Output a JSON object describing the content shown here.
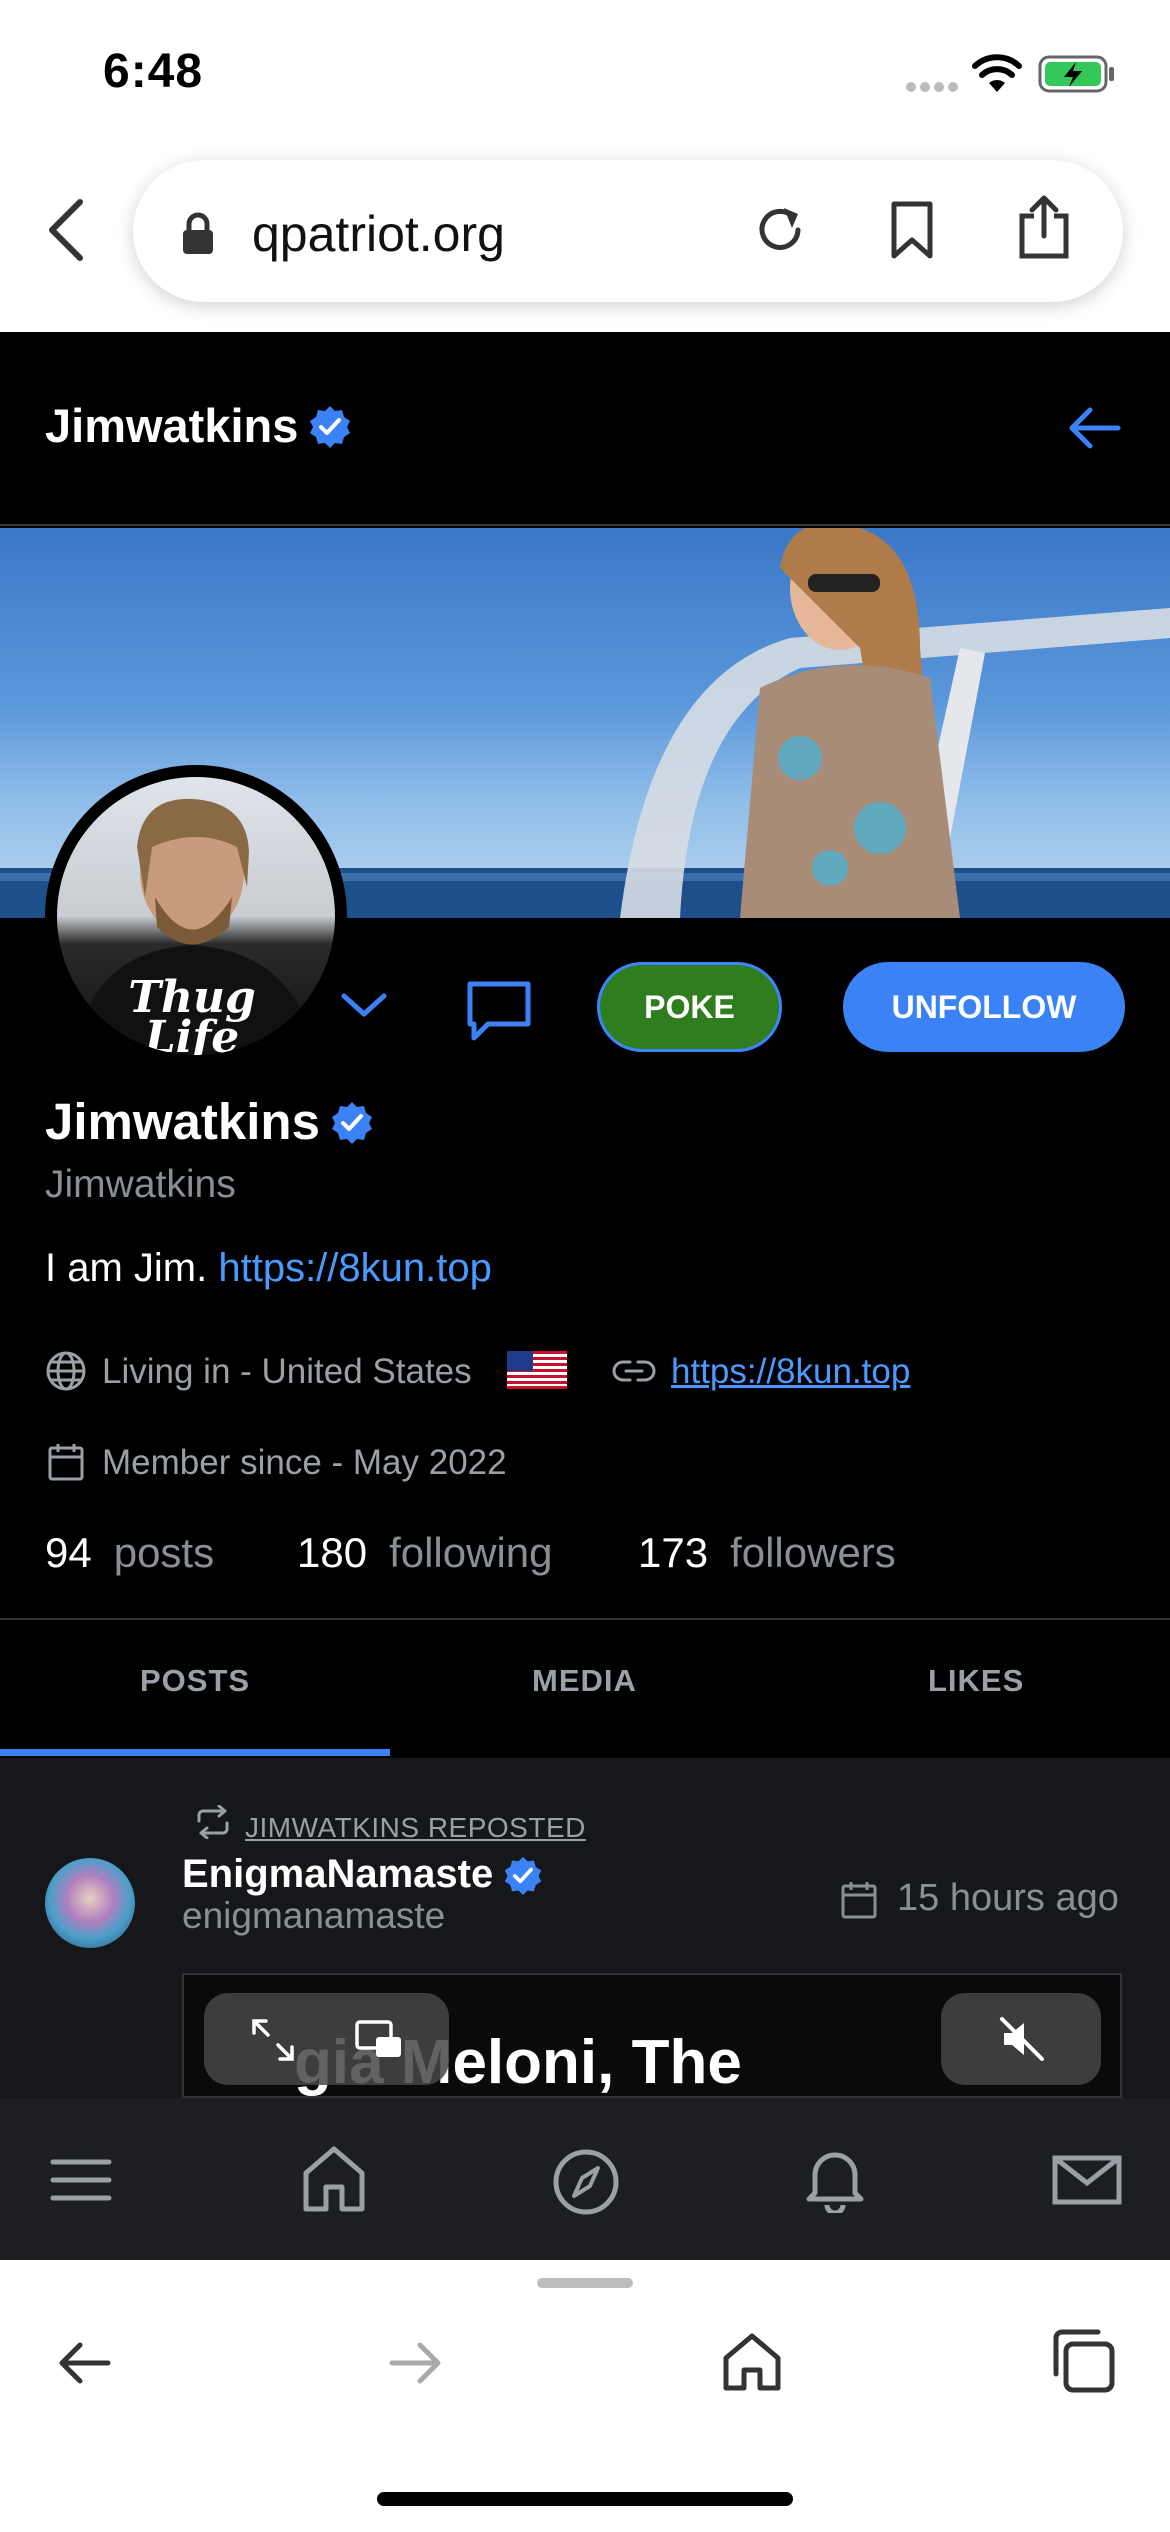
{
  "status_bar": {
    "time": "6:48"
  },
  "browser": {
    "url": "qpatriot.org"
  },
  "header": {
    "title": "Jimwatkins"
  },
  "profile": {
    "name": "Jimwatkins",
    "handle": "Jimwatkins",
    "bio_text": "I am Jim. ",
    "bio_link": "https://8kun.top",
    "location": "Living in - United States",
    "website": "https://8kun.top",
    "member_since": "Member since - May 2022",
    "poke_label": "POKE",
    "unfollow_label": "UNFOLLOW",
    "stats": {
      "posts_count": "94",
      "posts_label": "posts",
      "following_count": "180",
      "following_label": "following",
      "followers_count": "173",
      "followers_label": "followers"
    }
  },
  "tabs": [
    {
      "label": "POSTS",
      "active": true
    },
    {
      "label": "MEDIA",
      "active": false
    },
    {
      "label": "LIKES",
      "active": false
    }
  ],
  "post": {
    "reposted_by": "JIMWATKINS REPOSTED",
    "author_name": "EnigmaNamaste",
    "author_handle": "enigmanamaste",
    "time": "15 hours ago",
    "video_text": "gia Meloni, The"
  },
  "colors": {
    "accent": "#3b82f6",
    "poke": "#2f7d1f",
    "verified": "#3b82f6"
  }
}
